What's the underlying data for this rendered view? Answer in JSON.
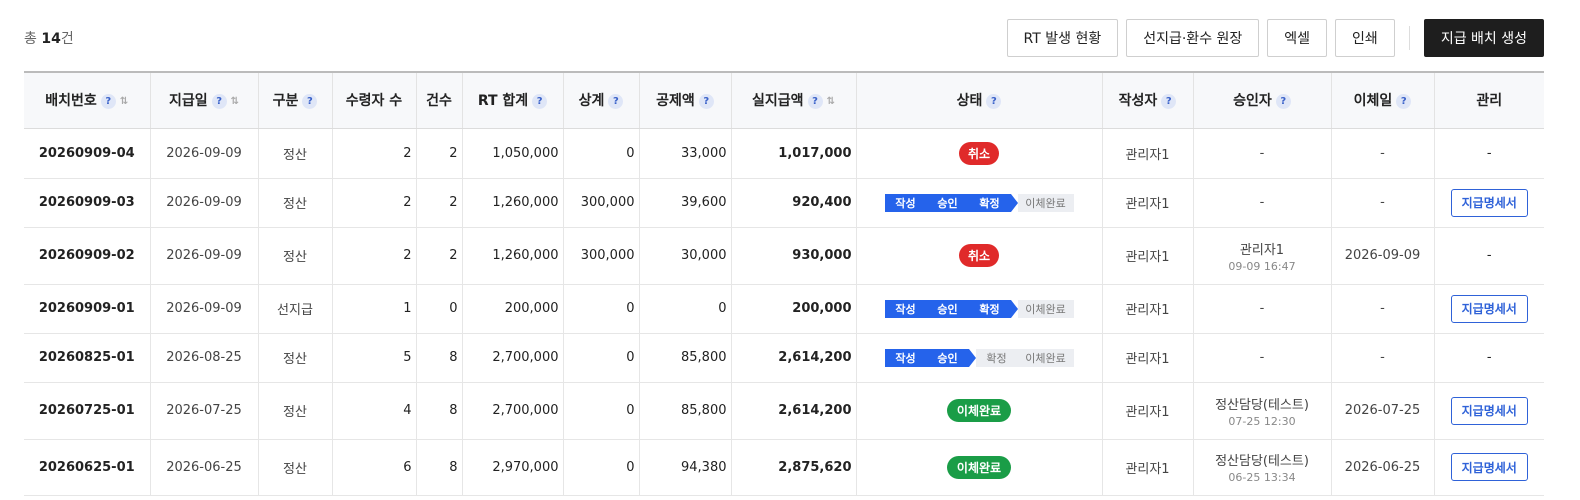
{
  "summary": {
    "prefix": "총",
    "count": "14",
    "suffix": "건"
  },
  "toolbar": {
    "rt_status": "RT 발생 현황",
    "ledger": "선지급·환수 원장",
    "excel": "엑셀",
    "print": "인쇄",
    "create_batch": "지급 배치 생성"
  },
  "columns": {
    "batch_no": "배치번호",
    "pay_date": "지급일",
    "type": "구분",
    "recipients": "수령자 수",
    "cases": "건수",
    "rt_total": "RT 합계",
    "offset": "상계",
    "deduction": "공제액",
    "net_pay": "실지급액",
    "status": "상태",
    "author": "작성자",
    "approver": "승인자",
    "transfer_date": "이체일",
    "manage": "관리"
  },
  "help_mark": "?",
  "sort_mark": "⇅",
  "progress_steps": {
    "s1": "작성",
    "s2": "승인",
    "s3": "확정",
    "s4": "이체완료"
  },
  "rows": [
    {
      "batch_no": "20260909-04",
      "pay_date": "2026-09-09",
      "type": "정산",
      "recipients": "2",
      "cases": "2",
      "rt_total": "1,050,000",
      "offset": "0",
      "deduction": "33,000",
      "net_pay": "1,017,000",
      "status": "취소",
      "author": "관리자1",
      "approver": "-",
      "approver_time": "",
      "transfer_date": "-",
      "manage": "-"
    },
    {
      "batch_no": "20260909-03",
      "pay_date": "2026-09-09",
      "type": "정산",
      "recipients": "2",
      "cases": "2",
      "rt_total": "1,260,000",
      "offset": "300,000",
      "deduction": "39,600",
      "net_pay": "920,400",
      "status": "확정",
      "author": "관리자1",
      "approver": "-",
      "approver_time": "",
      "transfer_date": "-",
      "manage": "지급명세서"
    },
    {
      "batch_no": "20260909-02",
      "pay_date": "2026-09-09",
      "type": "정산",
      "recipients": "2",
      "cases": "2",
      "rt_total": "1,260,000",
      "offset": "300,000",
      "deduction": "30,000",
      "net_pay": "930,000",
      "status": "취소",
      "author": "관리자1",
      "approver": "관리자1",
      "approver_time": "09-09 16:47",
      "transfer_date": "2026-09-09",
      "manage": "-"
    },
    {
      "batch_no": "20260909-01",
      "pay_date": "2026-09-09",
      "type": "선지급",
      "recipients": "1",
      "cases": "0",
      "rt_total": "200,000",
      "offset": "0",
      "deduction": "0",
      "net_pay": "200,000",
      "status": "확정",
      "author": "관리자1",
      "approver": "-",
      "approver_time": "",
      "transfer_date": "-",
      "manage": "지급명세서"
    },
    {
      "batch_no": "20260825-01",
      "pay_date": "2026-08-25",
      "type": "정산",
      "recipients": "5",
      "cases": "8",
      "rt_total": "2,700,000",
      "offset": "0",
      "deduction": "85,800",
      "net_pay": "2,614,200",
      "status": "승인",
      "author": "관리자1",
      "approver": "-",
      "approver_time": "",
      "transfer_date": "-",
      "manage": "-"
    },
    {
      "batch_no": "20260725-01",
      "pay_date": "2026-07-25",
      "type": "정산",
      "recipients": "4",
      "cases": "8",
      "rt_total": "2,700,000",
      "offset": "0",
      "deduction": "85,800",
      "net_pay": "2,614,200",
      "status": "이체완료",
      "author": "관리자1",
      "approver": "정산담당(테스트)",
      "approver_time": "07-25 12:30",
      "transfer_date": "2026-07-25",
      "manage": "지급명세서"
    },
    {
      "batch_no": "20260625-01",
      "pay_date": "2026-06-25",
      "type": "정산",
      "recipients": "6",
      "cases": "8",
      "rt_total": "2,970,000",
      "offset": "0",
      "deduction": "94,380",
      "net_pay": "2,875,620",
      "status": "이체완료",
      "author": "관리자1",
      "approver": "정산담당(테스트)",
      "approver_time": "06-25 13:34",
      "transfer_date": "2026-06-25",
      "manage": "지급명세서"
    }
  ],
  "colors": {
    "accent_blue": "#2563eb",
    "cancel_red": "#e02a2a",
    "done_green": "#1a9d47",
    "dark_button": "#1e1e1e"
  }
}
